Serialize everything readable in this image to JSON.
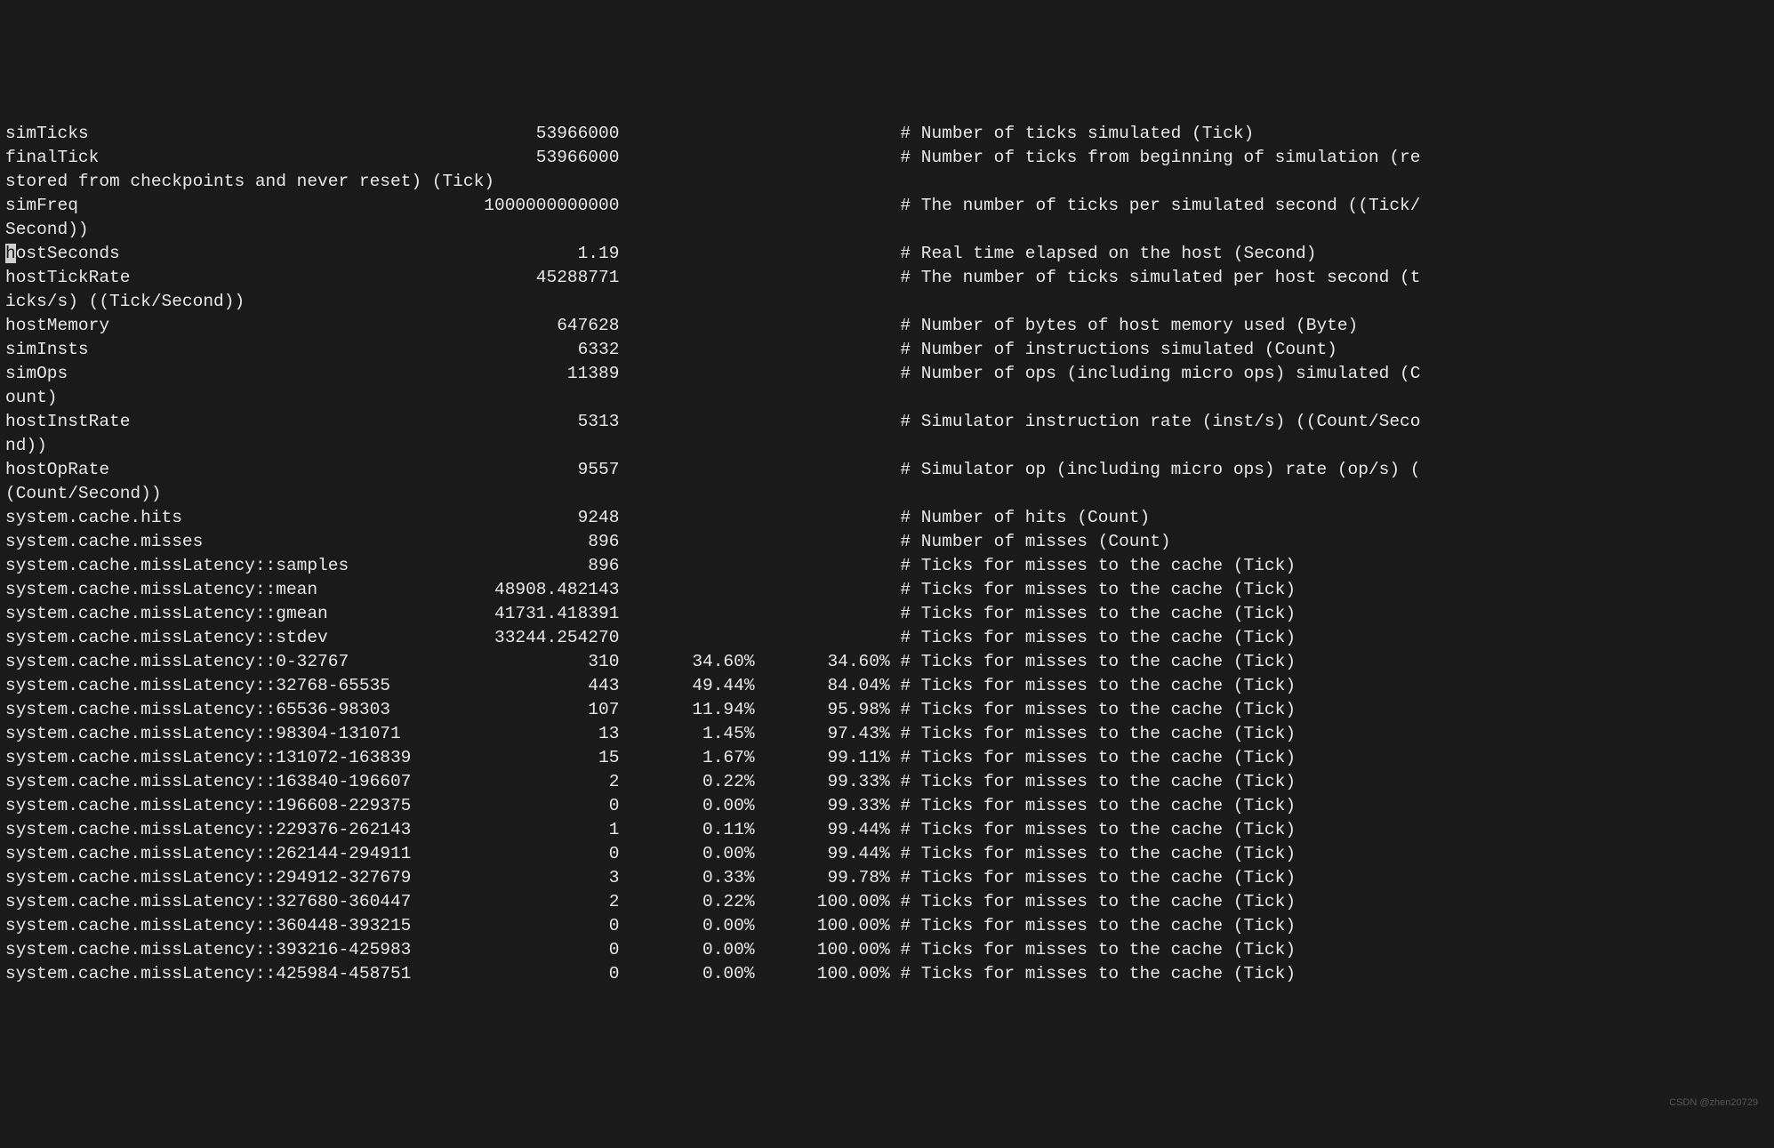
{
  "cols": 136,
  "labelWidth": 39,
  "valueWidth": 20,
  "pctWidth": 13,
  "cumWidth": 13,
  "stats": [
    {
      "name": "simTicks",
      "value": "53966000",
      "desc": "Number of ticks simulated (Tick)"
    },
    {
      "name": "finalTick",
      "value": "53966000",
      "desc": "Number of ticks from beginning of simulation (restored from checkpoints and never reset) (Tick)"
    },
    {
      "name": "simFreq",
      "value": "1000000000000",
      "desc": "The number of ticks per simulated second ((Tick/Second))"
    },
    {
      "name": "hostSeconds",
      "value": "1.19",
      "desc": "Real time elapsed on the host (Second)",
      "highlightFirst": true
    },
    {
      "name": "hostTickRate",
      "value": "45288771",
      "desc": "The number of ticks simulated per host second (ticks/s) ((Tick/Second))"
    },
    {
      "name": "hostMemory",
      "value": "647628",
      "desc": "Number of bytes of host memory used (Byte)"
    },
    {
      "name": "simInsts",
      "value": "6332",
      "desc": "Number of instructions simulated (Count)"
    },
    {
      "name": "simOps",
      "value": "11389",
      "desc": "Number of ops (including micro ops) simulated (Count)"
    },
    {
      "name": "hostInstRate",
      "value": "5313",
      "desc": "Simulator instruction rate (inst/s) ((Count/Second))"
    },
    {
      "name": "hostOpRate",
      "value": "9557",
      "desc": "Simulator op (including micro ops) rate (op/s) ((Count/Second))"
    },
    {
      "name": "system.cache.hits",
      "value": "9248",
      "desc": "Number of hits (Count)"
    },
    {
      "name": "system.cache.misses",
      "value": "896",
      "desc": "Number of misses (Count)"
    },
    {
      "name": "system.cache.missLatency::samples",
      "value": "896",
      "desc": "Ticks for misses to the cache (Tick)"
    },
    {
      "name": "system.cache.missLatency::mean",
      "value": "48908.482143",
      "desc": "Ticks for misses to the cache (Tick)"
    },
    {
      "name": "system.cache.missLatency::gmean",
      "value": "41731.418391",
      "desc": "Ticks for misses to the cache (Tick)"
    },
    {
      "name": "system.cache.missLatency::stdev",
      "value": "33244.254270",
      "desc": "Ticks for misses to the cache (Tick)"
    },
    {
      "name": "system.cache.missLatency::0-32767",
      "value": "310",
      "pct": "34.60%",
      "cum": "34.60%",
      "desc": "Ticks for misses to the cache (Tick)"
    },
    {
      "name": "system.cache.missLatency::32768-65535",
      "value": "443",
      "pct": "49.44%",
      "cum": "84.04%",
      "desc": "Ticks for misses to the cache (Tick)"
    },
    {
      "name": "system.cache.missLatency::65536-98303",
      "value": "107",
      "pct": "11.94%",
      "cum": "95.98%",
      "desc": "Ticks for misses to the cache (Tick)"
    },
    {
      "name": "system.cache.missLatency::98304-131071",
      "value": "13",
      "pct": "1.45%",
      "cum": "97.43%",
      "desc": "Ticks for misses to the cache (Tick)"
    },
    {
      "name": "system.cache.missLatency::131072-163839",
      "value": "15",
      "pct": "1.67%",
      "cum": "99.11%",
      "desc": "Ticks for misses to the cache (Tick)"
    },
    {
      "name": "system.cache.missLatency::163840-196607",
      "value": "2",
      "pct": "0.22%",
      "cum": "99.33%",
      "desc": "Ticks for misses to the cache (Tick)"
    },
    {
      "name": "system.cache.missLatency::196608-229375",
      "value": "0",
      "pct": "0.00%",
      "cum": "99.33%",
      "desc": "Ticks for misses to the cache (Tick)"
    },
    {
      "name": "system.cache.missLatency::229376-262143",
      "value": "1",
      "pct": "0.11%",
      "cum": "99.44%",
      "desc": "Ticks for misses to the cache (Tick)"
    },
    {
      "name": "system.cache.missLatency::262144-294911",
      "value": "0",
      "pct": "0.00%",
      "cum": "99.44%",
      "desc": "Ticks for misses to the cache (Tick)"
    },
    {
      "name": "system.cache.missLatency::294912-327679",
      "value": "3",
      "pct": "0.33%",
      "cum": "99.78%",
      "desc": "Ticks for misses to the cache (Tick)"
    },
    {
      "name": "system.cache.missLatency::327680-360447",
      "value": "2",
      "pct": "0.22%",
      "cum": "100.00%",
      "desc": "Ticks for misses to the cache (Tick)"
    },
    {
      "name": "system.cache.missLatency::360448-393215",
      "value": "0",
      "pct": "0.00%",
      "cum": "100.00%",
      "desc": "Ticks for misses to the cache (Tick)"
    },
    {
      "name": "system.cache.missLatency::393216-425983",
      "value": "0",
      "pct": "0.00%",
      "cum": "100.00%",
      "desc": "Ticks for misses to the cache (Tick)"
    },
    {
      "name": "system.cache.missLatency::425984-458751",
      "value": "0",
      "pct": "0.00%",
      "cum": "100.00%",
      "desc": "Ticks for misses to the cache (Tick)"
    }
  ],
  "watermark": "CSDN @zhen20729"
}
